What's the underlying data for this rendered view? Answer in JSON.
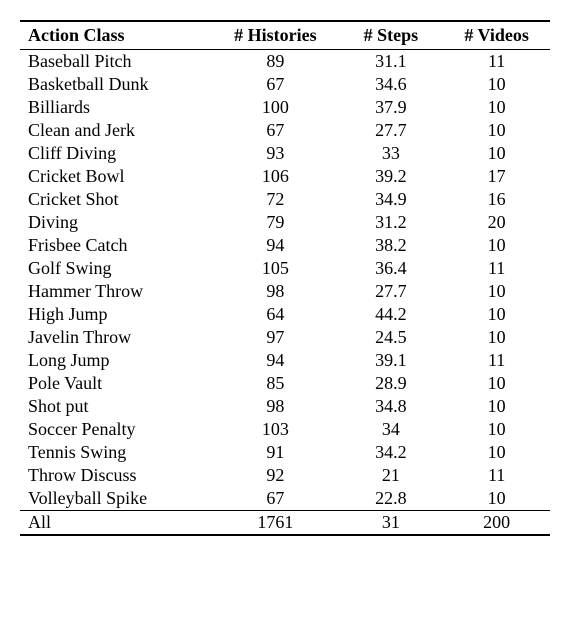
{
  "chart_data": {
    "type": "table",
    "headers": [
      "Action Class",
      "# Histories",
      "# Steps",
      "# Videos"
    ],
    "rows": [
      {
        "action_class": "Baseball Pitch",
        "histories": 89,
        "steps": 31.1,
        "videos": 11
      },
      {
        "action_class": "Basketball Dunk",
        "histories": 67,
        "steps": 34.6,
        "videos": 10
      },
      {
        "action_class": "Billiards",
        "histories": 100,
        "steps": 37.9,
        "videos": 10
      },
      {
        "action_class": "Clean and Jerk",
        "histories": 67,
        "steps": 27.7,
        "videos": 10
      },
      {
        "action_class": "Cliff Diving",
        "histories": 93,
        "steps": 33.0,
        "videos": 10
      },
      {
        "action_class": "Cricket Bowl",
        "histories": 106,
        "steps": 39.2,
        "videos": 17
      },
      {
        "action_class": "Cricket Shot",
        "histories": 72,
        "steps": 34.9,
        "videos": 16
      },
      {
        "action_class": "Diving",
        "histories": 79,
        "steps": 31.2,
        "videos": 20
      },
      {
        "action_class": "Frisbee Catch",
        "histories": 94,
        "steps": 38.2,
        "videos": 10
      },
      {
        "action_class": "Golf Swing",
        "histories": 105,
        "steps": 36.4,
        "videos": 11
      },
      {
        "action_class": "Hammer Throw",
        "histories": 98,
        "steps": 27.7,
        "videos": 10
      },
      {
        "action_class": "High Jump",
        "histories": 64,
        "steps": 44.2,
        "videos": 10
      },
      {
        "action_class": "Javelin Throw",
        "histories": 97,
        "steps": 24.5,
        "videos": 10
      },
      {
        "action_class": "Long Jump",
        "histories": 94,
        "steps": 39.1,
        "videos": 11
      },
      {
        "action_class": "Pole Vault",
        "histories": 85,
        "steps": 28.9,
        "videos": 10
      },
      {
        "action_class": "Shot put",
        "histories": 98,
        "steps": 34.8,
        "videos": 10
      },
      {
        "action_class": "Soccer Penalty",
        "histories": 103,
        "steps": 34.0,
        "videos": 10
      },
      {
        "action_class": "Tennis Swing",
        "histories": 91,
        "steps": 34.2,
        "videos": 10
      },
      {
        "action_class": "Throw Discuss",
        "histories": 92,
        "steps": 21.0,
        "videos": 11
      },
      {
        "action_class": "Volleyball Spike",
        "histories": 67,
        "steps": 22.8,
        "videos": 10
      }
    ],
    "summary": {
      "action_class": "All",
      "histories": 1761,
      "steps": 31.0,
      "videos": 200
    }
  }
}
